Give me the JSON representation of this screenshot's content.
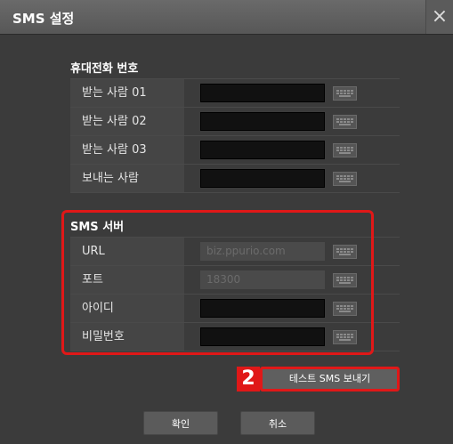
{
  "dialog": {
    "title": "SMS 설정",
    "close": "×"
  },
  "phone": {
    "heading": "휴대전화 번호",
    "rows": [
      {
        "label": "받는 사람 01",
        "value": ""
      },
      {
        "label": "받는 사람 02",
        "value": ""
      },
      {
        "label": "받는 사람 03",
        "value": ""
      },
      {
        "label": "보내는 사람",
        "value": ""
      }
    ]
  },
  "server": {
    "heading": "SMS 서버",
    "rows": [
      {
        "label": "URL",
        "value": "biz.ppurio.com"
      },
      {
        "label": "포트",
        "value": "18300"
      },
      {
        "label": "아이디",
        "value": ""
      },
      {
        "label": "비밀번호",
        "value": ""
      }
    ]
  },
  "callout": {
    "number": "2"
  },
  "buttons": {
    "test": "테스트 SMS 보내기",
    "ok": "확인",
    "cancel": "취소"
  },
  "colors": {
    "highlight": "#e01818",
    "background": "#3b3b3b"
  },
  "icons": {
    "keyboard": "keyboard-icon",
    "close": "close-icon"
  }
}
